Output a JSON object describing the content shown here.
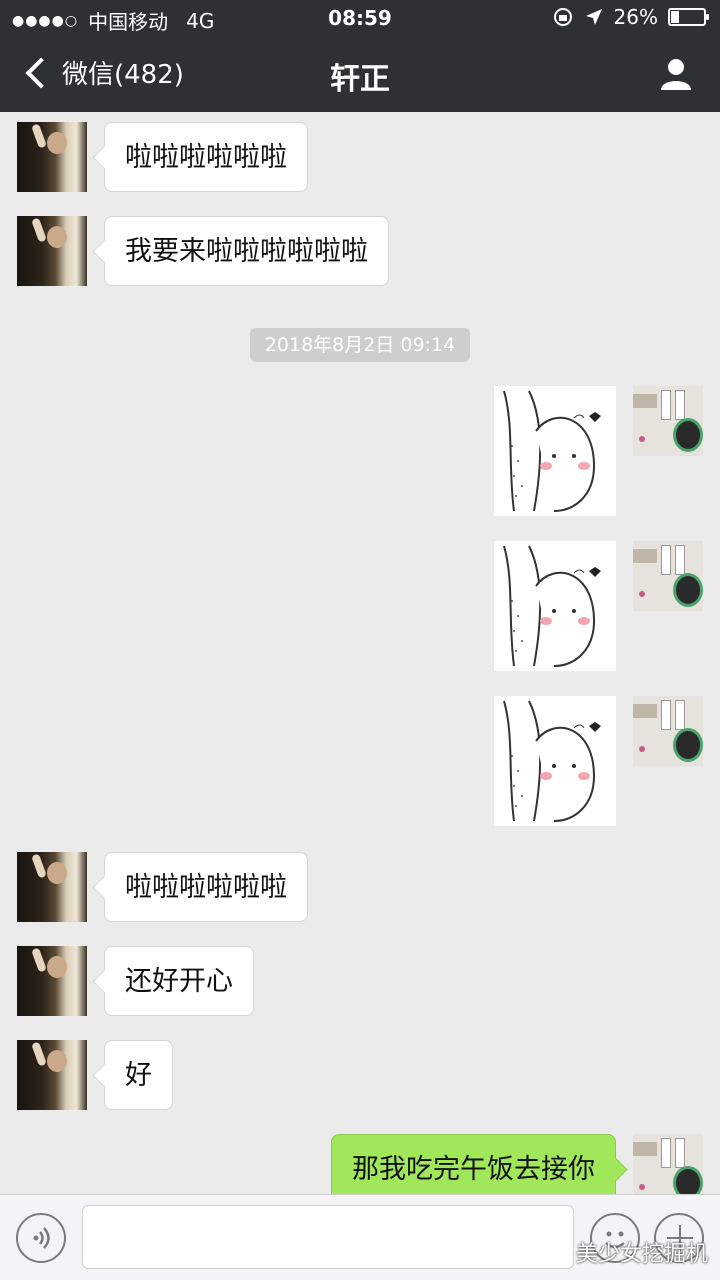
{
  "status_bar": {
    "signal_dots": "●●●●○",
    "carrier": "中国移动",
    "network": "4G",
    "time": "08:59",
    "battery": "26%",
    "battery_level": 0.26
  },
  "nav": {
    "back_label": "微信(482)",
    "title": "轩正"
  },
  "messages": [
    {
      "side": "left",
      "type": "text",
      "text": "啦啦啦啦啦啦"
    },
    {
      "side": "left",
      "type": "text",
      "text": "我要来啦啦啦啦啦啦"
    },
    {
      "type": "timestamp",
      "text": "2018年8月2日 09:14"
    },
    {
      "side": "right",
      "type": "sticker",
      "icon": "blushing-face-hug-sticker"
    },
    {
      "side": "right",
      "type": "sticker",
      "icon": "blushing-face-hug-sticker"
    },
    {
      "side": "right",
      "type": "sticker",
      "icon": "blushing-face-hug-sticker"
    },
    {
      "side": "left",
      "type": "text",
      "text": "啦啦啦啦啦啦"
    },
    {
      "side": "left",
      "type": "text",
      "text": "还好开心"
    },
    {
      "side": "left",
      "type": "text",
      "text": "好"
    },
    {
      "side": "right",
      "type": "text",
      "text": "那我吃完午饭去接你"
    }
  ],
  "input_bar": {
    "value": "",
    "watermark": "美少女挖掘机"
  },
  "colors": {
    "nav_bg": "#2e3132",
    "chat_bg": "#ebebeb",
    "sent_bubble": "#a0e75a",
    "received_bubble": "#ffffff"
  }
}
